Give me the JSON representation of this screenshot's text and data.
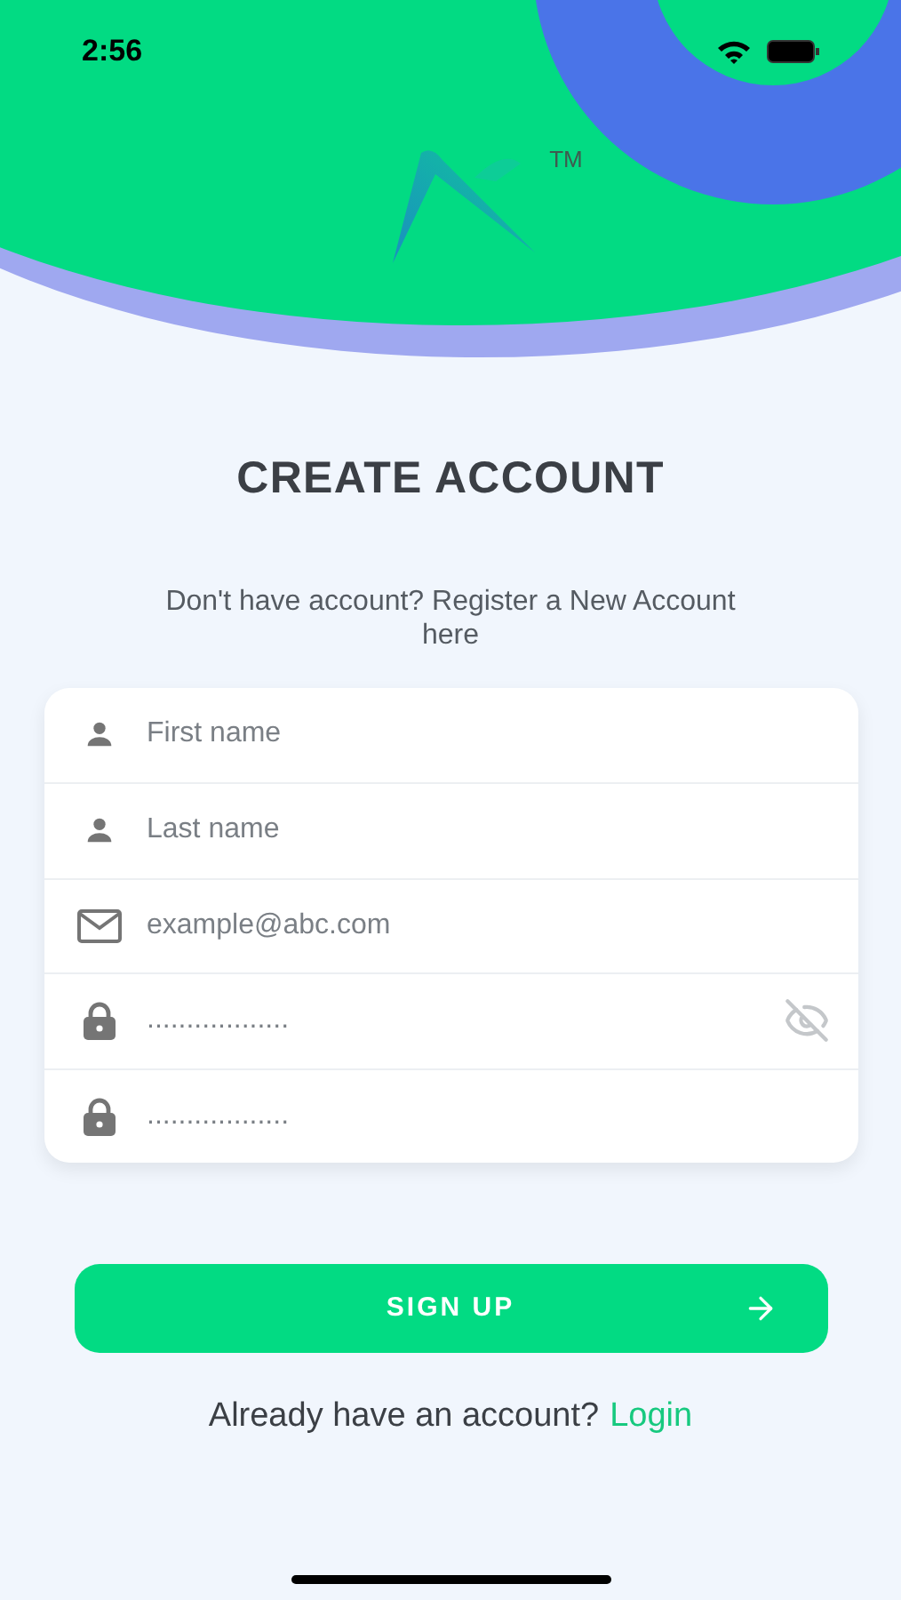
{
  "status_bar": {
    "time": "2:56"
  },
  "logo": {
    "trademark": "TM"
  },
  "title": "CREATE ACCOUNT",
  "subtitle": "Don't have account? Register a New Account here",
  "fields": [
    {
      "kind": "person",
      "placeholder": "First name"
    },
    {
      "kind": "person",
      "placeholder": "Last name"
    },
    {
      "kind": "email",
      "placeholder": "example@abc.com"
    },
    {
      "kind": "password",
      "placeholder": "..................",
      "password_visible": false
    },
    {
      "kind": "password",
      "placeholder": ".................."
    }
  ],
  "submit_button": {
    "label": "SIGN UP"
  },
  "login_prompt": {
    "text": "Already have an account?",
    "link": "Login"
  }
}
